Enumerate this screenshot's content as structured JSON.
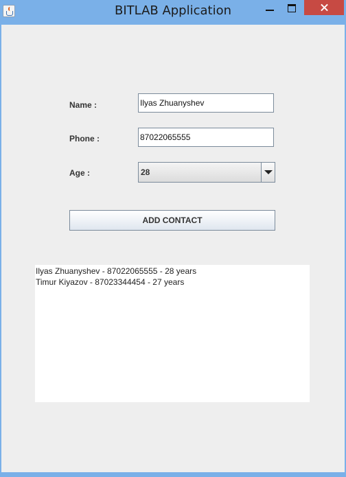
{
  "window": {
    "title": "BITLAB Application"
  },
  "form": {
    "name_label": "Name :",
    "name_value": "Ilyas Zhuanyshev",
    "phone_label": "Phone :",
    "phone_value": "87022065555",
    "age_label": "Age :",
    "age_value": "28",
    "add_button_label": "ADD CONTACT"
  },
  "contacts": {
    "items": [
      "Ilyas Zhuanyshev - 87022065555 - 28 years",
      "Timur Kiyazov - 87023344454 - 27 years"
    ]
  },
  "icons": {
    "app": "java-cup-icon",
    "minimize": "minimize-icon",
    "maximize": "maximize-icon",
    "close": "close-icon",
    "dropdown": "chevron-down-icon"
  },
  "colors": {
    "titlebar": "#7ab0e8",
    "close": "#c74a43",
    "panel": "#eeeeee"
  }
}
